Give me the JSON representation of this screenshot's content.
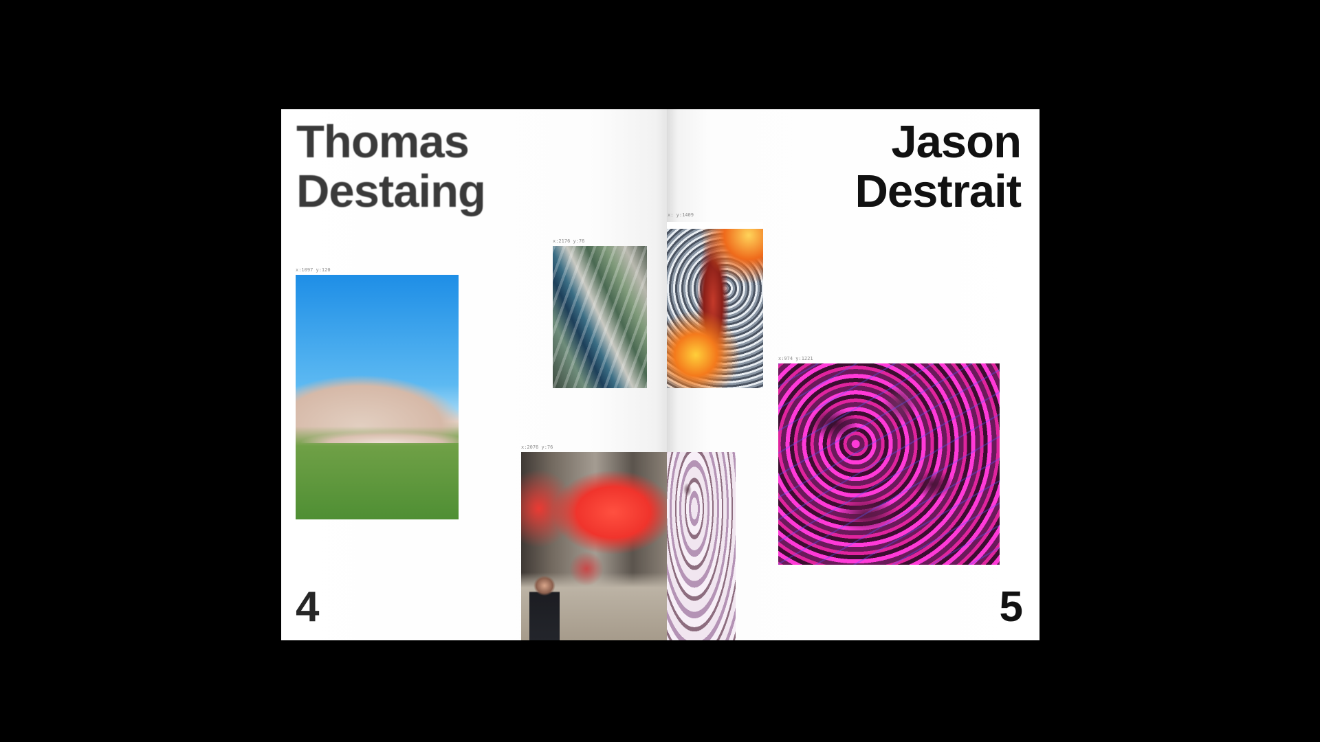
{
  "spread": {
    "left_page": {
      "name_first": "Thomas",
      "name_last": "Destaing",
      "page_number": "4",
      "coords": {
        "landscape": "x:1097  y:120",
        "aerial": "x:2176  y:76",
        "protest": "x:2076  y:76"
      }
    },
    "right_page": {
      "name_first": "Jason",
      "name_last": "Destrait",
      "page_number": "5",
      "coords": {
        "fire": "x:  y:1409",
        "magenta": "x:974  y:1221"
      }
    }
  },
  "colors": {
    "background": "#000000",
    "paper": "#ffffff",
    "text": "#222222"
  }
}
